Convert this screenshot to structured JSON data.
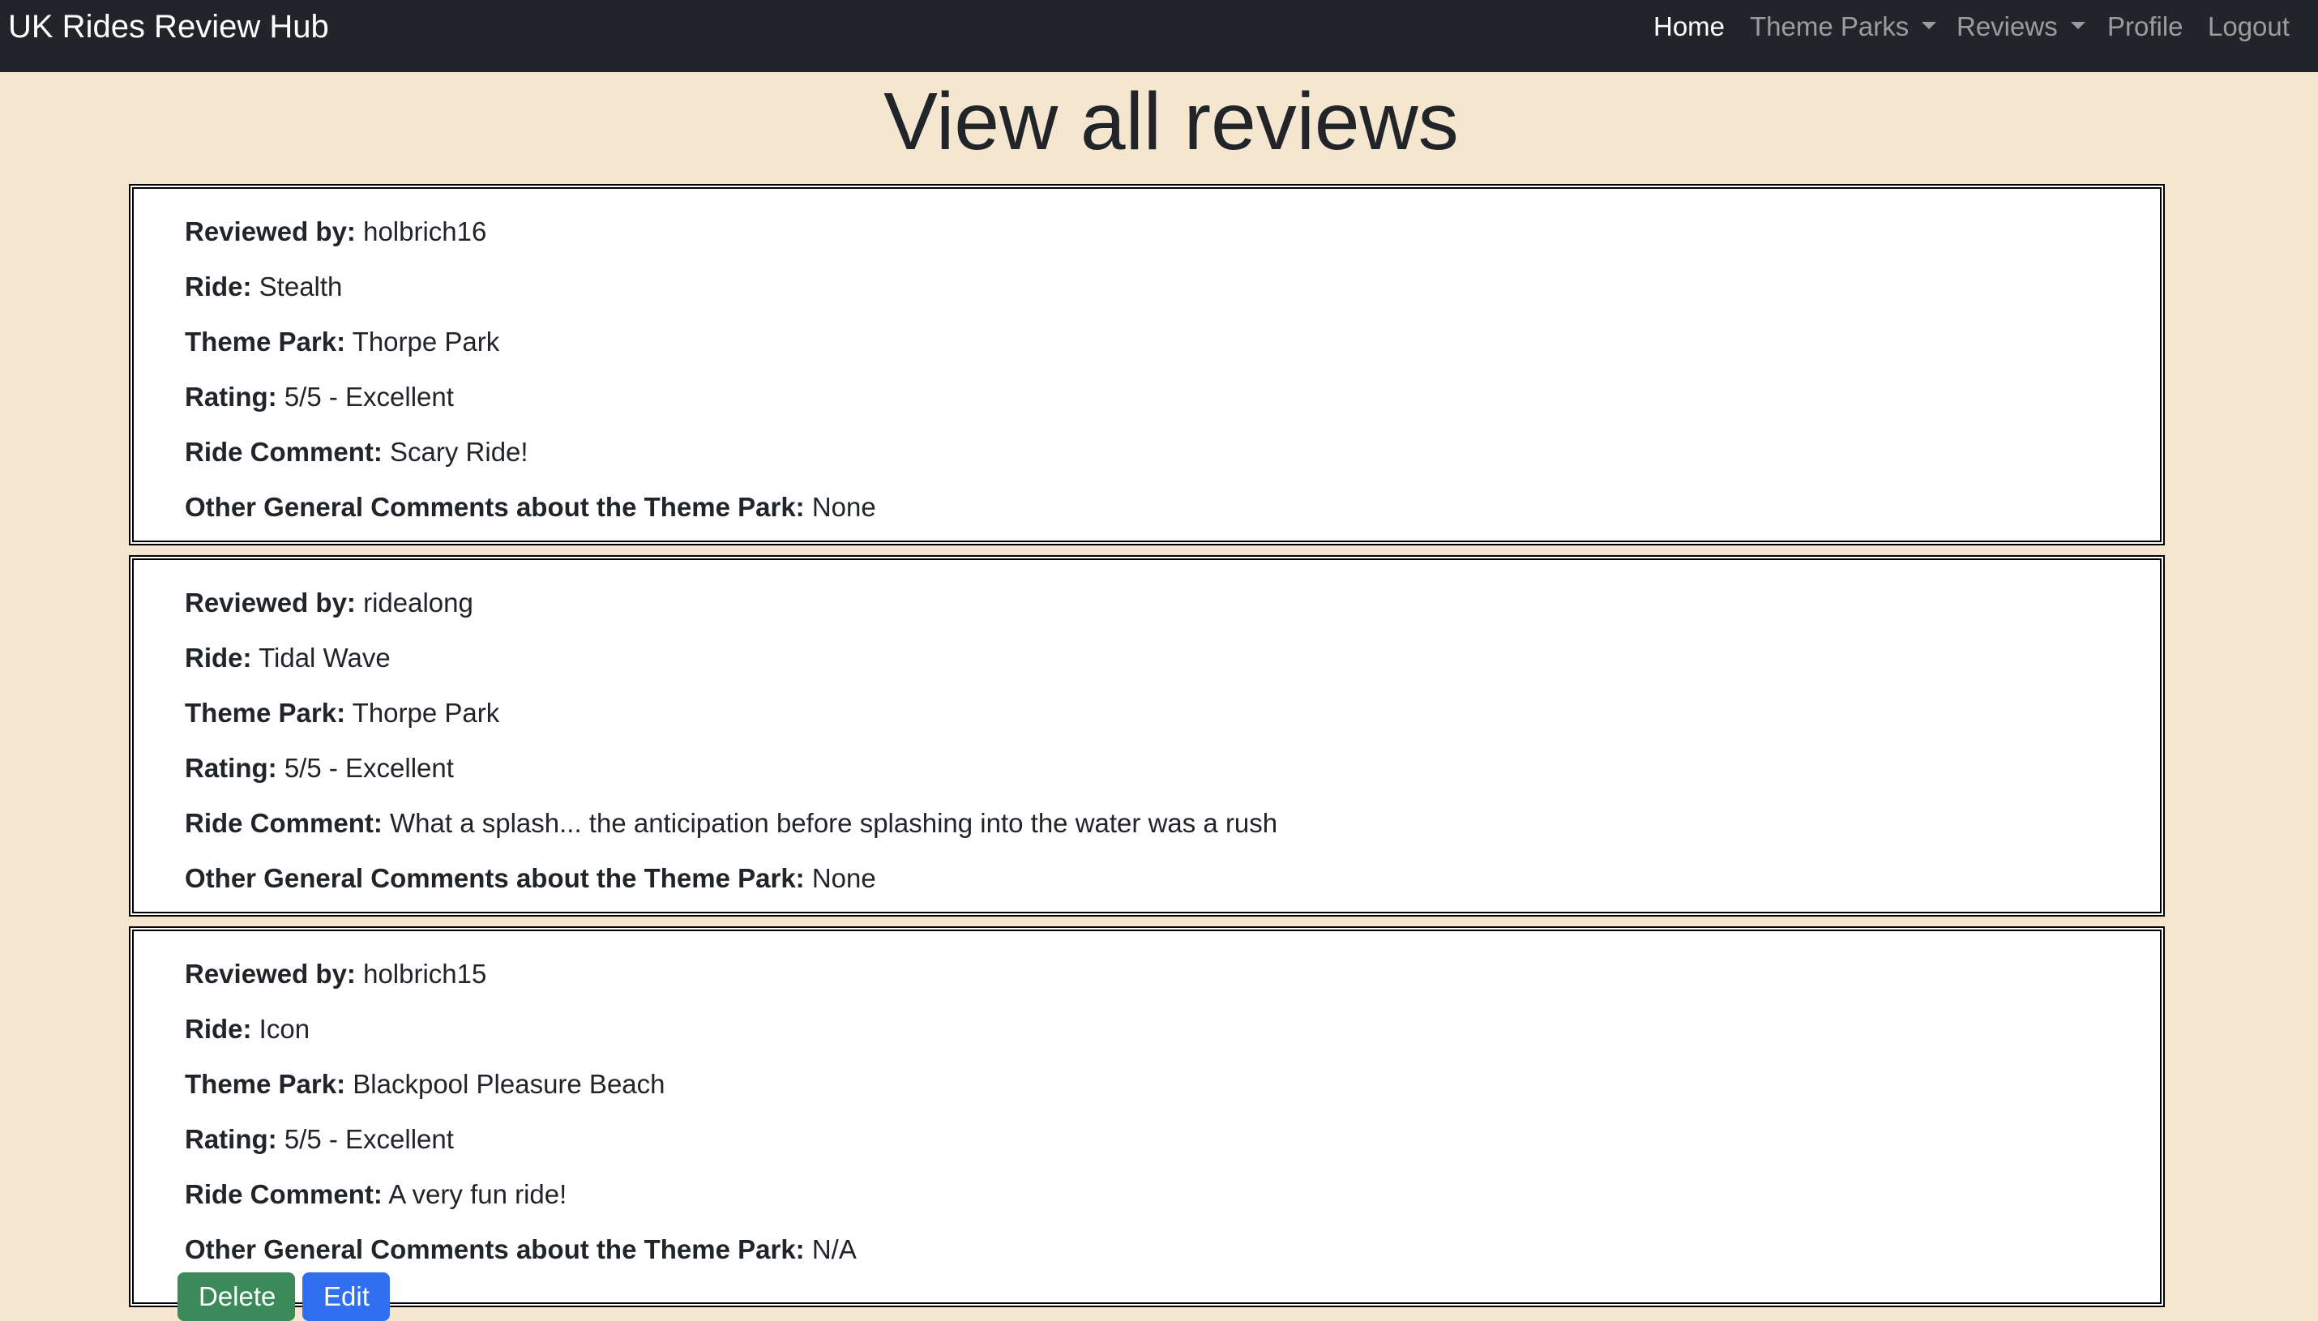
{
  "navbar": {
    "brand": "UK Rides Review Hub",
    "links": {
      "home": "Home",
      "theme_parks": "Theme Parks",
      "reviews": "Reviews",
      "profile": "Profile",
      "logout": "Logout"
    }
  },
  "page_title": "View all reviews",
  "field_labels": {
    "reviewed_by": "Reviewed by:",
    "ride": "Ride:",
    "theme_park": "Theme Park:",
    "rating": "Rating:",
    "ride_comment": "Ride Comment:",
    "general_comments": "Other General Comments about the Theme Park:"
  },
  "reviews": [
    {
      "reviewed_by": "holbrich16",
      "ride": "Stealth",
      "theme_park": "Thorpe Park",
      "rating": "5/5 - Excellent",
      "ride_comment": "Scary Ride!",
      "general_comments": "None"
    },
    {
      "reviewed_by": "ridealong",
      "ride": "Tidal Wave",
      "theme_park": "Thorpe Park",
      "rating": "5/5 - Excellent",
      "ride_comment": "What a splash... the anticipation before splashing into the water was a rush",
      "general_comments": "None"
    },
    {
      "reviewed_by": "holbrich15",
      "ride": "Icon",
      "theme_park": "Blackpool Pleasure Beach",
      "rating": "5/5 - Excellent",
      "ride_comment": "A very fun ride!",
      "general_comments": "N/A"
    }
  ],
  "actions": {
    "delete_label": "Delete",
    "edit_label": "Edit"
  },
  "colors": {
    "navbar_bg": "#212529",
    "page_bg": "#f5e6cf",
    "delete_button": "#3c8a5a",
    "edit_button": "#2f6ff0"
  }
}
